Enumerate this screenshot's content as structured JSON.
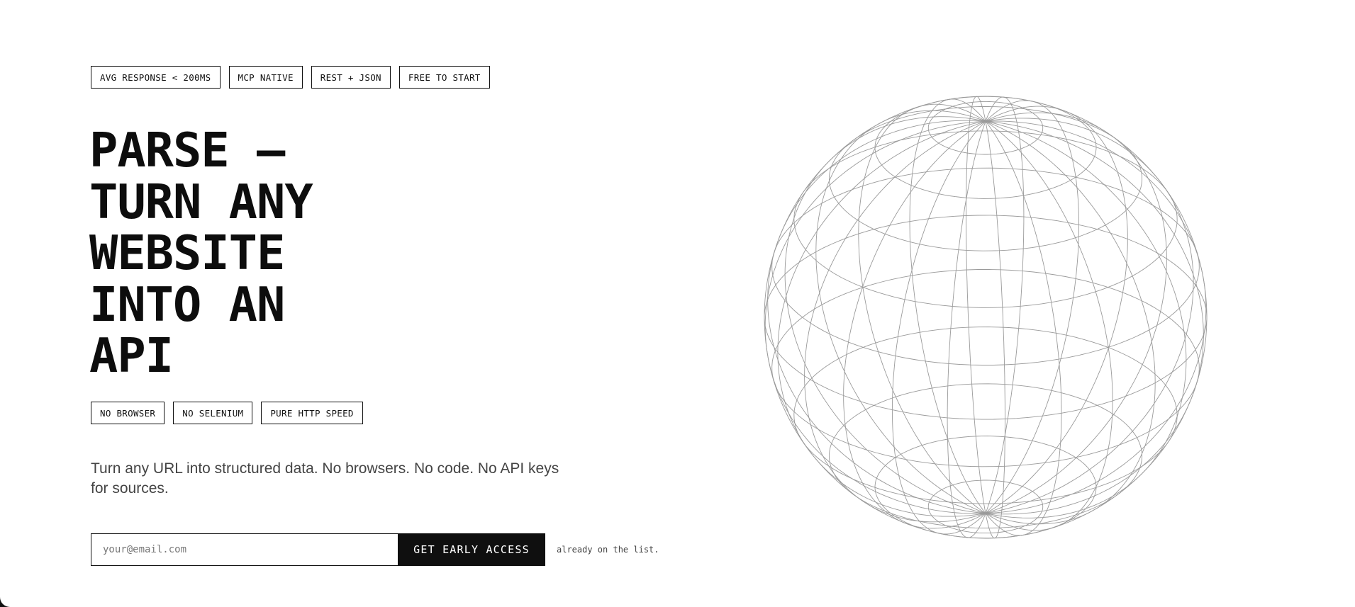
{
  "top_badges": [
    "AVG RESPONSE < 200MS",
    "MCP NATIVE",
    "REST + JSON",
    "FREE TO START"
  ],
  "headline_lines": [
    "PARSE —",
    "TURN ANY",
    "WEBSITE",
    "INTO AN",
    "API"
  ],
  "feature_badges": [
    "NO BROWSER",
    "NO SELENIUM",
    "PURE HTTP SPEED"
  ],
  "subtitle": "Turn any URL into structured data. No browsers. No code. No API keys for sources.",
  "signup": {
    "email_placeholder": "your@email.com",
    "email_value": "",
    "button_label": "GET EARLY ACCESS",
    "note": "already on the list."
  },
  "globe": {
    "icon": "wireframe-globe-icon",
    "stroke_color": "#9a9a9a"
  }
}
